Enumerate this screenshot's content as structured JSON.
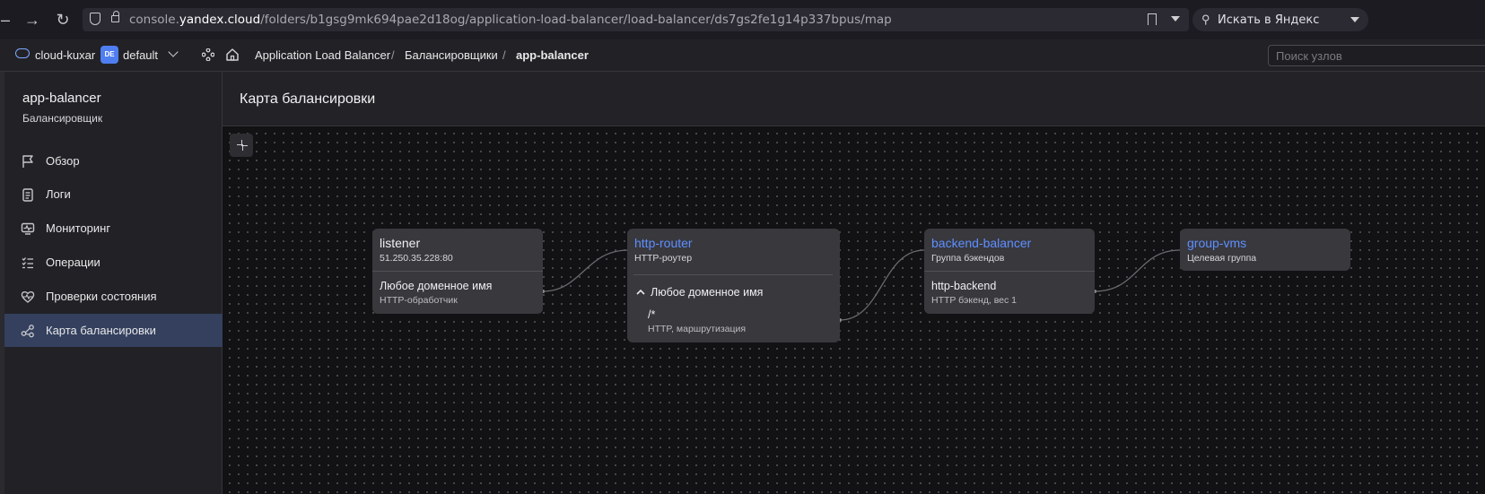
{
  "browser": {
    "url_host": "console.yandex.cloud",
    "url_prefix": "console.",
    "url_bold": "yandex.cloud",
    "url_path": "/folders/b1gsg9mk694pae2d18og/application-load-balancer/load-balancer/ds7gs2fe1g14p337bpus/map",
    "search_placeholder": "Искать в Яндекс"
  },
  "header": {
    "cloud_name": "cloud-kuxar",
    "folder_badge": "DE",
    "folder_name": "default",
    "breadcrumbs": [
      "Application Load Balancer",
      "Балансировщики",
      "app-balancer"
    ],
    "node_search_placeholder": "Поиск узлов"
  },
  "sidebar": {
    "title": "app-balancer",
    "subtitle": "Балансировщик",
    "items": [
      {
        "label": "Обзор",
        "icon": "flag-icon"
      },
      {
        "label": "Логи",
        "icon": "log-list-icon"
      },
      {
        "label": "Мониторинг",
        "icon": "monitor-icon"
      },
      {
        "label": "Операции",
        "icon": "operations-list-icon"
      },
      {
        "label": "Проверки состояния",
        "icon": "heart-pulse-icon"
      },
      {
        "label": "Карта балансировки",
        "icon": "nodes-share-icon",
        "active": true
      }
    ]
  },
  "main": {
    "title": "Карта балансировки",
    "nodes": {
      "listener": {
        "title": "listener",
        "subtitle": "51.250.35.228:80",
        "handler_title": "Любое доменное имя",
        "handler_sub": "HTTP-обработчик"
      },
      "router": {
        "title": "http-router",
        "subtitle": "HTTP-роутер",
        "vhost": "Любое доменное имя",
        "route_path": "/*",
        "route_sub": "HTTP, маршрутизация"
      },
      "backend_group": {
        "title": "backend-balancer",
        "subtitle": "Группа бэкендов",
        "backend_title": "http-backend",
        "backend_sub": "HTTP бэкенд, вес 1"
      },
      "target_group": {
        "title": "group-vms",
        "subtitle": "Целевая группа"
      }
    }
  },
  "colors": {
    "accent": "#5f8fff",
    "active_nav": "#34405e",
    "canvas_bg": "#121214",
    "node_bg": "#38383d"
  }
}
